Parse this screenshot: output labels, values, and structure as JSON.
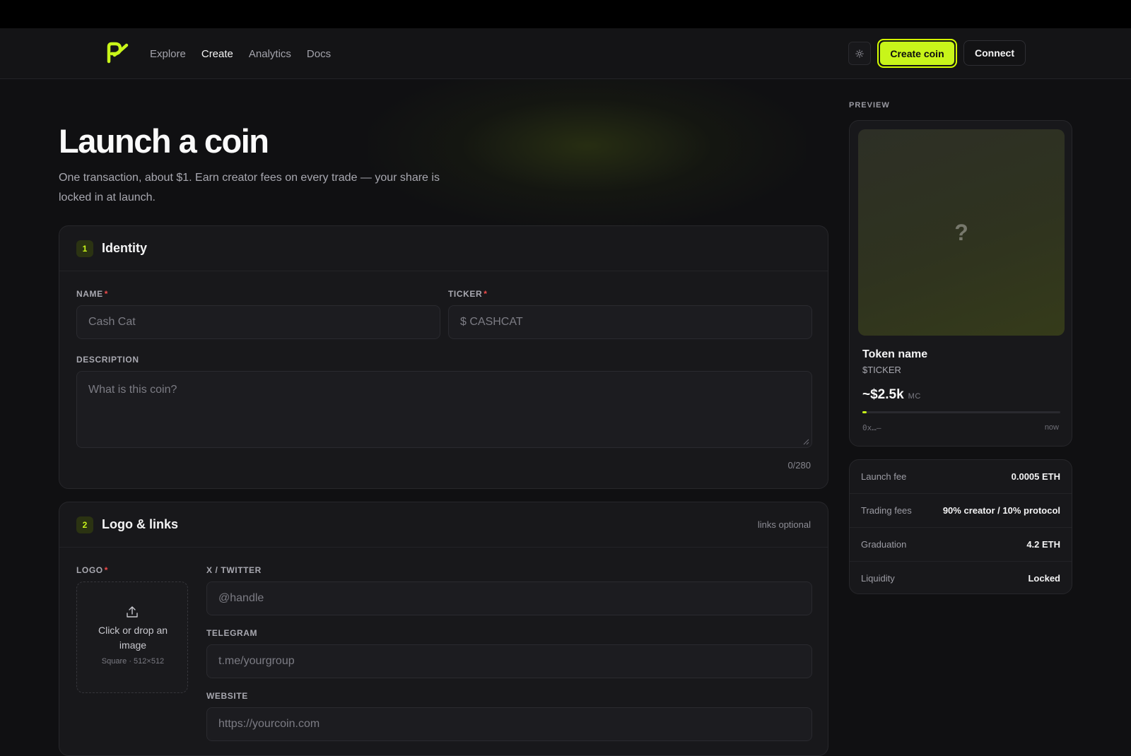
{
  "nav": {
    "links": [
      "Explore",
      "Create",
      "Analytics",
      "Docs"
    ],
    "active": "Create",
    "create_label": "Create coin",
    "connect_label": "Connect",
    "theme_icon": "sun-icon",
    "accent": "#c8f51a"
  },
  "hero": {
    "title": "Launch a coin",
    "subtitle": "One transaction, about $1. Earn creator fees on every trade — your share is locked in at launch."
  },
  "identity": {
    "step": "1",
    "title": "Identity",
    "name_label": "NAME",
    "name_placeholder": "Cash Cat",
    "ticker_label": "TICKER",
    "ticker_placeholder": "$ CASHCAT",
    "description_label": "DESCRIPTION",
    "description_placeholder": "What is this coin?",
    "counter": "0/280",
    "required_mark": "*"
  },
  "logo_links": {
    "step": "2",
    "title": "Logo & links",
    "note": "links optional",
    "logo_label": "LOGO",
    "upload_text": "Click or drop an image",
    "upload_hint": "Square · 512×512",
    "twitter_label": "X / TWITTER",
    "twitter_placeholder": "@handle",
    "telegram_label": "TELEGRAM",
    "telegram_placeholder": "t.me/yourgroup",
    "website_label": "WEBSITE",
    "website_placeholder": "https://yourcoin.com"
  },
  "preview": {
    "label": "PREVIEW",
    "placeholder_glyph": "?",
    "token_name": "Token name",
    "ticker": "$TICKER",
    "market_cap": "~$2.5k",
    "market_cap_unit": "MC",
    "progress_fraction": 0.01,
    "address": "0x…—",
    "time": "now"
  },
  "fees": [
    {
      "label": "Launch fee",
      "value": "0.0005 ETH"
    },
    {
      "label": "Trading fees",
      "value": "90% creator / 10% protocol"
    },
    {
      "label": "Graduation",
      "value": "4.2 ETH"
    },
    {
      "label": "Liquidity",
      "value": "Locked"
    }
  ]
}
